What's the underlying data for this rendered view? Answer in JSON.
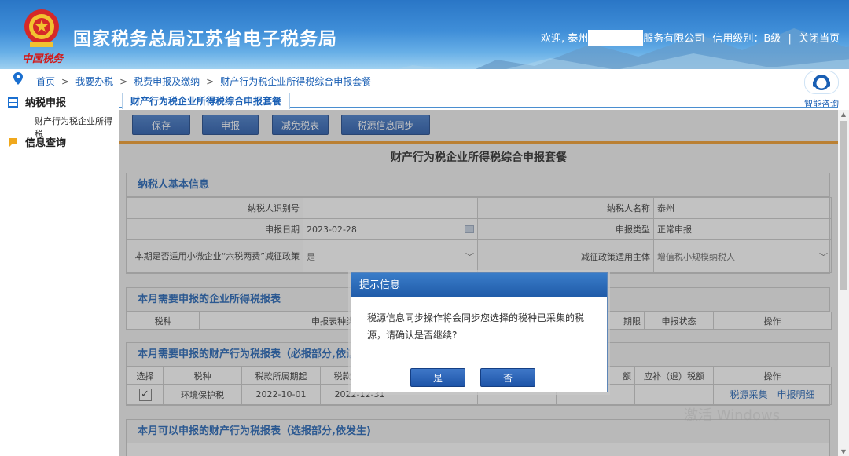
{
  "header": {
    "site_title": "国家税务总局江苏省电子税务局",
    "slogan": "中国税务",
    "welcome_prefix": "欢迎, 泰州",
    "company_suffix": "服务有限公司",
    "credit_level": "信用级别：B级",
    "close_page": "关闭当页"
  },
  "breadcrumb": [
    "首页",
    "我要办税",
    "税费申报及缴纳",
    "财产行为税企业所得税综合申报套餐"
  ],
  "breadcrumb_sep": ">",
  "help": {
    "label": "智能咨询"
  },
  "sidebar": {
    "items": [
      {
        "label": "纳税申报",
        "icon": "grid-icon"
      },
      {
        "label": "信息查询",
        "icon": "chat-icon"
      }
    ],
    "sub_item": "财产行为税企业所得税"
  },
  "tab": {
    "label": "财产行为税企业所得税综合申报套餐"
  },
  "toolbar": {
    "save": "保存",
    "declare": "申报",
    "exempt": "减免税表",
    "sync": "税源信息同步"
  },
  "form": {
    "title": "财产行为税企业所得税综合申报套餐",
    "basic": {
      "header": "纳税人基本信息",
      "taxpayer_id_label": "纳税人识别号",
      "taxpayer_id_value": "",
      "taxpayer_name_label": "纳税人名称",
      "taxpayer_name_value": "泰州",
      "date_label": "申报日期",
      "date_value": "2023-02-28",
      "type_label": "申报类型",
      "type_value": "正常申报",
      "policy_label": "本期是否适用小微企业“六税两费”减征政策",
      "policy_value": "是",
      "subject_label": "减征政策适用主体",
      "subject_value": "增值税小规模纳税人"
    },
    "cit": {
      "header": "本月需要申报的企业所得税报表",
      "columns": [
        "税种",
        "申报表种类",
        "期限",
        "申报状态",
        "操作"
      ]
    },
    "property_required": {
      "header": "本月需要申报的财产行为税报表（必报部分,依认定)",
      "columns": [
        "选择",
        "税种",
        "税款所属期起",
        "税款所属期止",
        "",
        "",
        "额",
        "应补（退）税额",
        "操作"
      ],
      "rows": [
        {
          "checked": "✓",
          "tax": "环境保护税",
          "start": "2022-10-01",
          "end": "2022-12-31",
          "amount": "",
          "refund": "",
          "op1": "税源采集",
          "op2": "申报明细"
        }
      ]
    },
    "property_optional": {
      "header": "本月可以申报的财产行为税报表（选报部分,依发生)"
    }
  },
  "modal": {
    "title": "提示信息",
    "message": "税源信息同步操作将会同步您选择的税种已采集的税源，请确认是否继续?",
    "yes": "是",
    "no": "否"
  },
  "watermark": "激活 Windows"
}
